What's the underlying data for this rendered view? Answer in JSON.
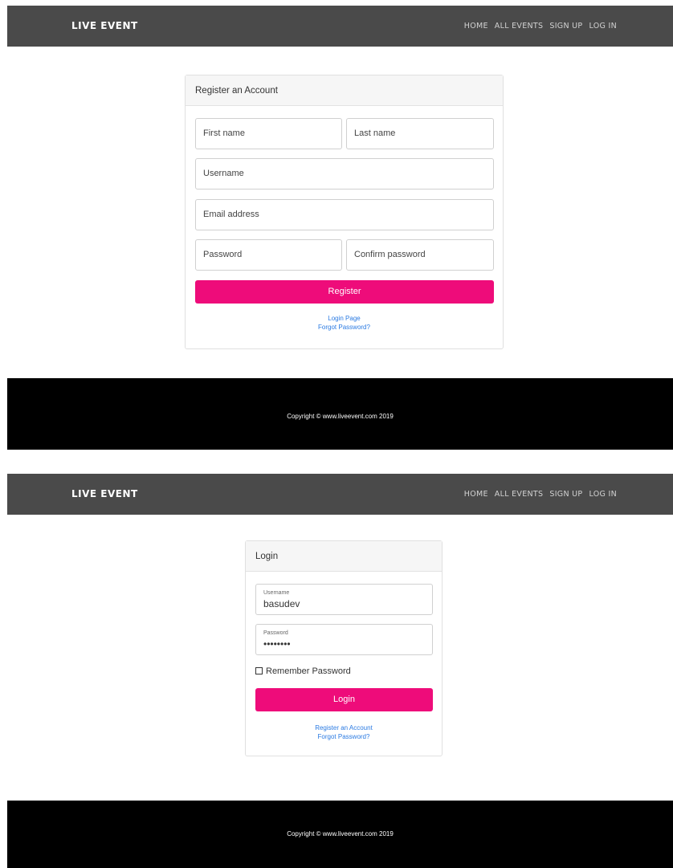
{
  "brand": "LIVE EVENT",
  "nav": [
    "HOME",
    "ALL EVENTS",
    "SIGN UP",
    "LOG IN"
  ],
  "register": {
    "title": "Register an Account",
    "first_name_placeholder": "First name",
    "last_name_placeholder": "Last name",
    "username_placeholder": "Username",
    "email_placeholder": "Email address",
    "password_placeholder": "Password",
    "confirm_placeholder": "Confirm password",
    "button": "Register",
    "link_login": "Login Page",
    "link_forgot": "Forgot Password?"
  },
  "login": {
    "title": "Login",
    "username_label": "Username",
    "username_value": "basudev",
    "password_label": "Password",
    "password_value": "••••••••",
    "remember": "Remember Password",
    "button": "Login",
    "link_register": "Register an Account",
    "link_forgot": "Forgot Password?"
  },
  "footer": "Copyright © www.liveevent.com 2019",
  "colors": {
    "navbar": "#4a4a4a",
    "accent": "#ee0c7a",
    "link": "#2a7ae2",
    "footer": "#000000"
  }
}
